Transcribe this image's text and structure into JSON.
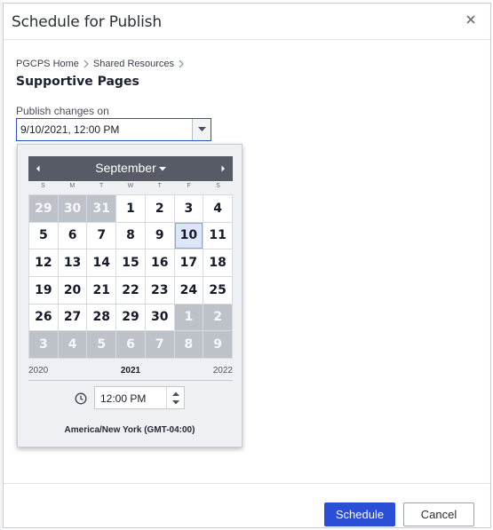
{
  "dialog": {
    "title": "Schedule for Publish",
    "close_icon": "close-icon"
  },
  "breadcrumb": {
    "items": [
      "PGCPS Home",
      "Shared Resources"
    ]
  },
  "page_title": "Supportive Pages",
  "publish": {
    "label": "Publish changes on",
    "value": "9/10/2021, 12:00 PM"
  },
  "calendar": {
    "month": "September",
    "weekdays": [
      "S",
      "M",
      "T",
      "W",
      "T",
      "F",
      "S"
    ],
    "weeks": [
      [
        {
          "d": "29",
          "o": true
        },
        {
          "d": "30",
          "o": true
        },
        {
          "d": "31",
          "o": true
        },
        {
          "d": "1"
        },
        {
          "d": "2"
        },
        {
          "d": "3"
        },
        {
          "d": "4"
        }
      ],
      [
        {
          "d": "5"
        },
        {
          "d": "6"
        },
        {
          "d": "7"
        },
        {
          "d": "8"
        },
        {
          "d": "9"
        },
        {
          "d": "10",
          "s": true
        },
        {
          "d": "11"
        }
      ],
      [
        {
          "d": "12"
        },
        {
          "d": "13"
        },
        {
          "d": "14"
        },
        {
          "d": "15"
        },
        {
          "d": "16"
        },
        {
          "d": "17"
        },
        {
          "d": "18"
        }
      ],
      [
        {
          "d": "19"
        },
        {
          "d": "20"
        },
        {
          "d": "21"
        },
        {
          "d": "22"
        },
        {
          "d": "23"
        },
        {
          "d": "24"
        },
        {
          "d": "25"
        }
      ],
      [
        {
          "d": "26"
        },
        {
          "d": "27"
        },
        {
          "d": "28"
        },
        {
          "d": "29"
        },
        {
          "d": "30"
        },
        {
          "d": "1",
          "o": true
        },
        {
          "d": "2",
          "o": true
        }
      ],
      [
        {
          "d": "3",
          "o": true
        },
        {
          "d": "4",
          "o": true
        },
        {
          "d": "5",
          "o": true
        },
        {
          "d": "6",
          "o": true
        },
        {
          "d": "7",
          "o": true
        },
        {
          "d": "8",
          "o": true
        },
        {
          "d": "9",
          "o": true
        }
      ]
    ],
    "year_prev": "2020",
    "year_current": "2021",
    "year_next": "2022",
    "time": "12:00 PM",
    "timezone": "America/New York (GMT-04:00)"
  },
  "buttons": {
    "schedule": "Schedule",
    "cancel": "Cancel"
  },
  "colors": {
    "primary": "#2a4ed6",
    "month_bar": "#565b66",
    "other_month_day": "#bdc2c8",
    "selected_day": "#dce6fb"
  }
}
